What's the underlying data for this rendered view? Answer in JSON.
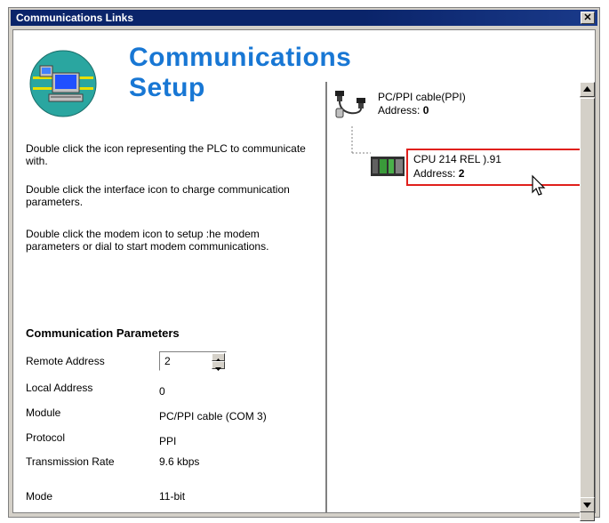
{
  "window": {
    "title": "Communications Links",
    "close_label": "✕"
  },
  "header": {
    "title": "Communications Setup",
    "logo_icon": "computer-network-icon"
  },
  "instructions": [
    "Double click the icon representing the PLC to communicate with.",
    "Double click the interface icon to charge communication parameters.",
    "Double click the modem icon to setup :he modem parameters or dial to start modem communications."
  ],
  "params": {
    "title": "Communication Parameters",
    "remote_address": {
      "label": "Remote Address",
      "value": "2"
    },
    "local_address": {
      "label": "Local Address",
      "value": "0"
    },
    "module": {
      "label": "Module",
      "value": "PC/PPI cable (COM 3)"
    },
    "protocol": {
      "label": "Protocol",
      "value": "PPI"
    },
    "transmission_rate": {
      "label": "Transmission Rate",
      "value": "9.6 kbps"
    },
    "mode": {
      "label": "Mode",
      "value": "11-bit"
    }
  },
  "tree": {
    "cable": {
      "name": "PC/PPI cable(PPI)",
      "address_label": "Address:",
      "address_value": "0",
      "icon": "cable-connector-icon"
    },
    "cpu": {
      "name": "CPU 214 REL ).91",
      "address_label": "Address:",
      "address_value": "2",
      "icon": "plc-module-icon"
    }
  },
  "colors": {
    "title_blue": "#1877d4",
    "titlebar": "#0a246a",
    "selection_border": "#e0201c"
  }
}
